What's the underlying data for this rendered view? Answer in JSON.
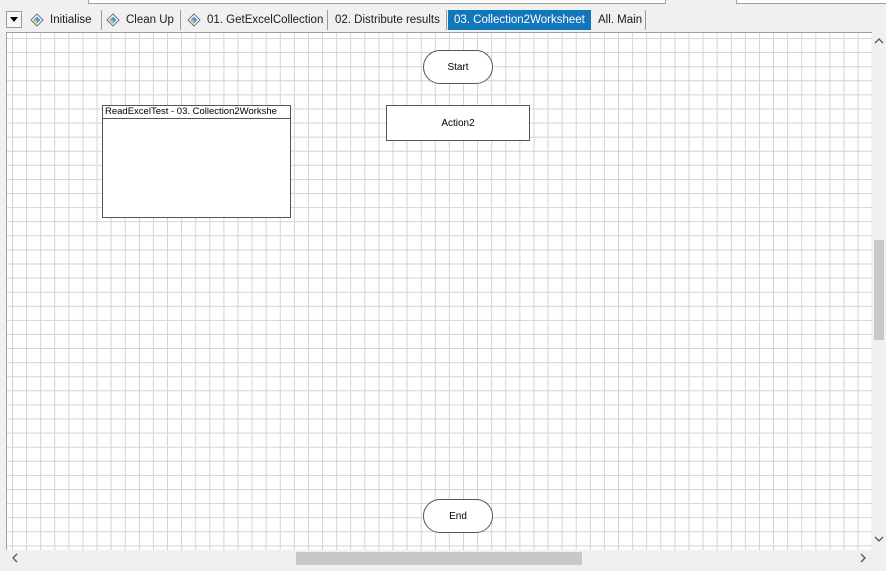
{
  "tabs": [
    {
      "label": "Initialise",
      "icon": "blueprism-process-icon",
      "active": false
    },
    {
      "label": "Clean Up",
      "icon": "blueprism-process-icon",
      "active": false
    },
    {
      "label": "01. GetExcelCollection",
      "icon": "blueprism-process-icon",
      "active": false
    },
    {
      "label": "02. Distribute results",
      "icon": "",
      "active": false
    },
    {
      "label": "03. Collection2Worksheet",
      "icon": "",
      "active": true
    },
    {
      "label": "All. Main",
      "icon": "",
      "active": false
    }
  ],
  "diagram": {
    "start_label": "Start",
    "action_label": "Action2",
    "end_label": "End",
    "block_title": "ReadExcelTest  -  03. Collection2Workshe"
  },
  "scroll_icons": {
    "up": "chevron-up-icon",
    "down": "chevron-down-icon",
    "left": "chevron-left-icon",
    "right": "chevron-right-icon"
  },
  "colors": {
    "active_tab": "#1177bb",
    "grid_line": "#d4d4d4"
  }
}
